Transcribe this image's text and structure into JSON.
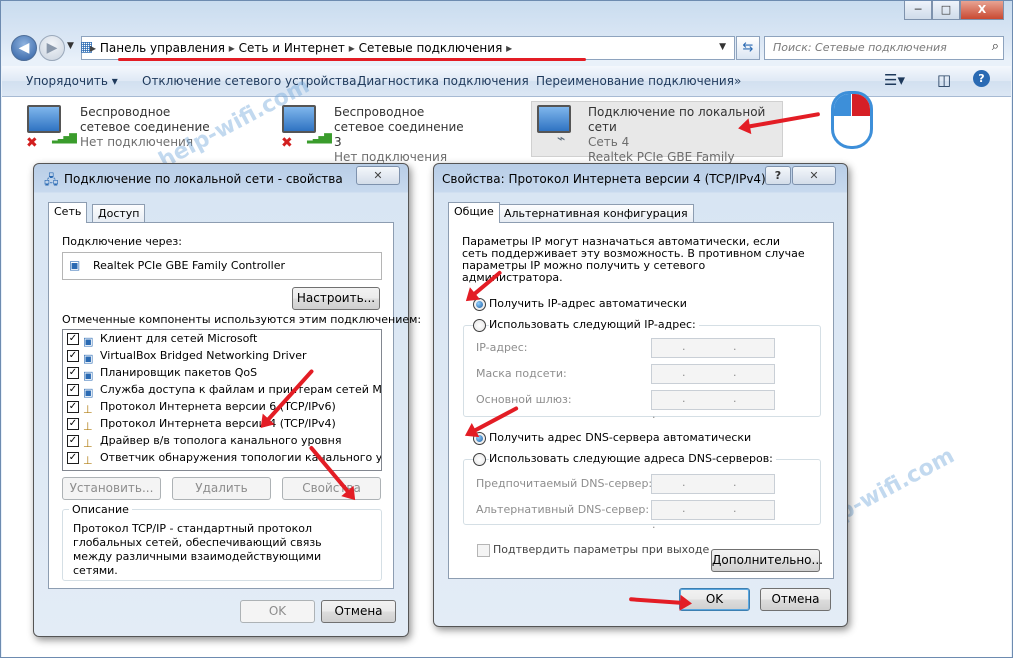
{
  "window": {
    "address_crumbs": [
      "Панель управления",
      "Сеть и Интернет",
      "Сетевые подключения"
    ],
    "search_placeholder": "Поиск: Сетевые подключения",
    "controls": {
      "minimize": "─",
      "maximize": "□",
      "close": "X"
    }
  },
  "toolbar": {
    "items": [
      "Упорядочить ▾",
      "Отключение сетевого устройства",
      "Диагностика подключения",
      "Переименование подключения",
      "»"
    ]
  },
  "connections": [
    {
      "name": "Беспроводное сетевое соединение",
      "status": "Нет подключения",
      "device": ""
    },
    {
      "name": "Беспроводное сетевое соединение 3",
      "status": "Нет подключения",
      "device": ""
    },
    {
      "name": "Подключение по локальной сети",
      "status": "Сеть  4",
      "device": "Realtek PCIe GBE Family Controller"
    }
  ],
  "watermark": "help-wifi.com",
  "lan_dialog": {
    "title": "Подключение по локальной сети - свойства",
    "tabs": [
      "Сеть",
      "Доступ"
    ],
    "connect_using_label": "Подключение через:",
    "adapter": "Realtek PCIe GBE Family Controller",
    "configure_button": "Настроить...",
    "components_label": "Отмеченные компоненты используются этим подключением:",
    "components": [
      {
        "label": "Клиент для сетей Microsoft",
        "checked": true
      },
      {
        "label": "VirtualBox Bridged Networking Driver",
        "checked": true
      },
      {
        "label": "Планировщик пакетов QoS",
        "checked": true
      },
      {
        "label": "Служба доступа к файлам и принтерам сетей Micro...",
        "checked": true
      },
      {
        "label": "Протокол Интернета версии 6 (TCP/IPv6)",
        "checked": true
      },
      {
        "label": "Протокол Интернета версии 4 (TCP/IPv4)",
        "checked": true
      },
      {
        "label": "Драйвер в/в тополога канального уровня",
        "checked": true
      },
      {
        "label": "Ответчик обнаружения топологии канального уровня",
        "checked": true
      }
    ],
    "install_button": "Установить...",
    "uninstall_button": "Удалить",
    "properties_button": "Свойства",
    "description_title": "Описание",
    "description_text": "Протокол TCP/IP - стандартный протокол глобальных сетей, обеспечивающий связь между различными взаимодействующими сетями.",
    "ok_button": "OK",
    "cancel_button": "Отмена"
  },
  "ipv4_dialog": {
    "title": "Свойства: Протокол Интернета версии 4 (TCP/IPv4)",
    "help": "?",
    "tabs": [
      "Общие",
      "Альтернативная конфигурация"
    ],
    "intro": "Параметры IP могут назначаться автоматически, если сеть поддерживает эту возможность. В противном случае параметры IP можно получить у сетевого администратора.",
    "radio_ip_auto": "Получить IP-адрес автоматически",
    "radio_ip_manual": "Использовать следующий IP-адрес:",
    "ip_label": "IP-адрес:",
    "mask_label": "Маска подсети:",
    "gateway_label": "Основной шлюз:",
    "radio_dns_auto": "Получить адрес DNS-сервера автоматически",
    "radio_dns_manual": "Использовать следующие адреса DNS-серверов:",
    "dns_pref_label": "Предпочитаемый DNS-сервер:",
    "dns_alt_label": "Альтернативный DNS-сервер:",
    "ip_placeholder": ". . .",
    "validate_label": "Подтвердить параметры при выходе",
    "advanced_button": "Дополнительно...",
    "ok_button": "OK",
    "cancel_button": "Отмена"
  },
  "colors": {
    "annotation_arrow": "#e31d25",
    "accent": "#3c7fb1"
  }
}
